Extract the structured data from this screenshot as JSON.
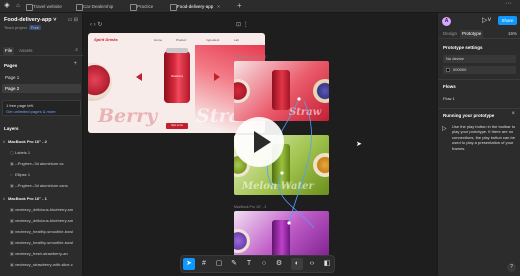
{
  "tabs": [
    {
      "label": "Travel website"
    },
    {
      "label": "Car-Dealership"
    },
    {
      "label": "Practice"
    },
    {
      "label": "Food-delivery-app",
      "active": true
    }
  ],
  "left_panel": {
    "project_name": "Food-delivery-app",
    "team": "Team project",
    "plan": "Free",
    "file_tabs": [
      "File",
      "Assets"
    ],
    "pages_title": "Pages",
    "pages": [
      "Page 1",
      "Page 2"
    ],
    "active_page": "Page 2",
    "notice_line1": "1 free page left.",
    "notice_line2": "Get unlimited pages & more",
    "layers_title": "Layers",
    "layers": [
      {
        "label": "MacBook Pro 16\" - 2",
        "type": "frame"
      },
      {
        "label": "Labels 1",
        "type": "group"
      },
      {
        "label": "--Pngtree--3d aluminium ca",
        "type": "image"
      },
      {
        "label": "Ellipse 1",
        "type": "shape"
      },
      {
        "label": "--Pngtree--3d aluminium cans",
        "type": "image"
      },
      {
        "label": "MacBook Pro 16\" - 1",
        "type": "frame"
      },
      {
        "label": "vecteezy_delicious-blueberry-sm",
        "type": "image"
      },
      {
        "label": "vecteezy_delicious-blueberry-sm",
        "type": "image"
      },
      {
        "label": "vecteezy_healthy-smoothie-bowl",
        "type": "image"
      },
      {
        "label": "vecteezy_healthy-smoothie-bowl",
        "type": "image"
      },
      {
        "label": "vecteezy_fresh-strawberry-an",
        "type": "image"
      },
      {
        "label": "vecteezy_strawberry-with-slice-c",
        "type": "image"
      }
    ]
  },
  "canvas": {
    "frame_label_top": "MacBook Pro 16\" - 2",
    "frame_label_bottom": "MacBook Pro 16\" - 3",
    "main_frame": {
      "brand": "Spirit Drinks",
      "nav": [
        "Home",
        "Product",
        "Ingredient",
        "Lab"
      ],
      "can_label": "Strawberry",
      "word_left": "Berry",
      "word_right": "Straw",
      "button": "Spin to Go"
    },
    "thumbs": [
      {
        "word": "Straw",
        "theme": "red"
      },
      {
        "word": "Melon  Water",
        "theme": "green"
      },
      {
        "word": "",
        "theme": "purple"
      }
    ]
  },
  "toolbar": {
    "tools": [
      "move-icon",
      "frame-icon",
      "pen-icon",
      "shape-icon",
      "text-icon",
      "comment-icon",
      "actions-icon",
      "dev-mode-icon",
      "code-icon"
    ]
  },
  "right_panel": {
    "avatar": "A",
    "share_label": "Share",
    "tabs": [
      "Design",
      "Prototype"
    ],
    "active_tab": "Prototype",
    "zoom": "16%",
    "prototype_settings_title": "Prototype settings",
    "device_value": "No device",
    "background_value": "000000",
    "background_color": "#000000",
    "flows_title": "Flows",
    "flow_item": "Flow 1",
    "running_title": "Running your prototype",
    "running_text": "Use the play button in the toolbar to play your prototype. If there are no connections, the play button can be used to play a presentation of your frames."
  },
  "colors": {
    "accent": "#0d99ff",
    "brand_red": "#c2202e"
  }
}
